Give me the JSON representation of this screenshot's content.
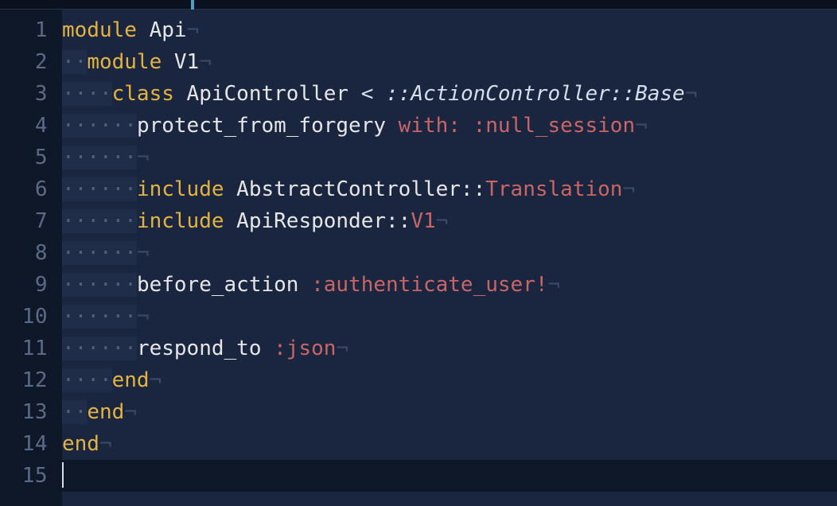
{
  "lineNumbers": [
    "1",
    "2",
    "3",
    "4",
    "5",
    "6",
    "7",
    "8",
    "9",
    "10",
    "11",
    "12",
    "13",
    "14",
    "15"
  ],
  "code": {
    "l1": {
      "kw1": "module",
      "c1": " Api"
    },
    "l2": {
      "ind": "  ",
      "kw1": "module",
      "c1": " V1"
    },
    "l3": {
      "ind": "    ",
      "kw1": "class",
      "c1": " ApiController ",
      "op": "< ",
      "base": "::ActionController::Base"
    },
    "l4": {
      "ind": "      ",
      "id": "protect_from_forgery ",
      "k": "with:",
      "sp": " ",
      "v": ":null_session"
    },
    "l5": {
      "ind": "      "
    },
    "l6": {
      "ind": "      ",
      "kw": "include",
      "sp": " ",
      "c": "AbstractController::",
      "t": "Translation"
    },
    "l7": {
      "ind": "      ",
      "kw": "include",
      "sp": " ",
      "c": "ApiResponder::",
      "t": "V1"
    },
    "l8": {
      "ind": "      "
    },
    "l9": {
      "ind": "      ",
      "id": "before_action ",
      "v": ":authenticate_user!"
    },
    "l10": {
      "ind": "      "
    },
    "l11": {
      "ind": "      ",
      "id": "respond_to ",
      "v": ":json"
    },
    "l12": {
      "ind": "    ",
      "kw": "end"
    },
    "l13": {
      "ind": "  ",
      "kw": "end"
    },
    "l14": {
      "kw": "end"
    }
  },
  "whitespace": {
    "dot": "·",
    "pilcrow": "¬"
  }
}
